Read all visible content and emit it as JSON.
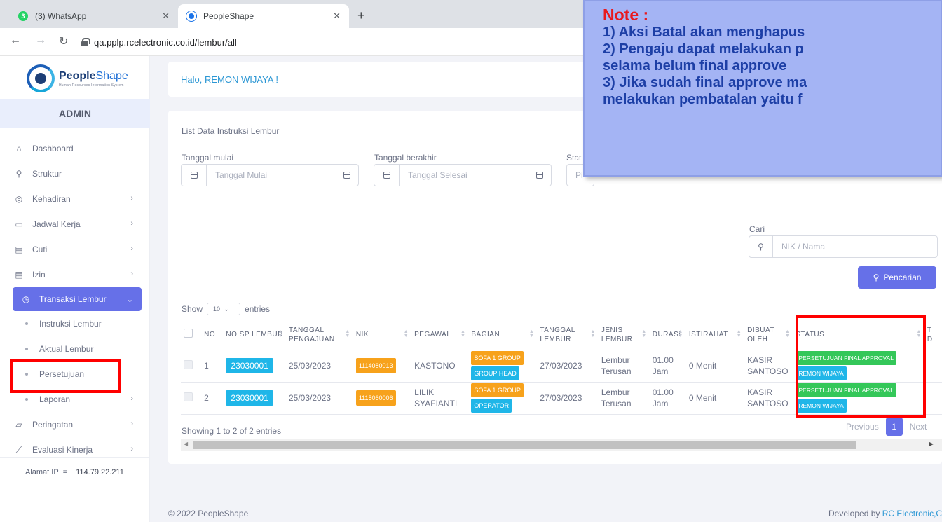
{
  "browser": {
    "tabs": [
      {
        "title": "(3) WhatsApp",
        "badge": "3"
      },
      {
        "title": "PeopleShape"
      }
    ],
    "url": "qa.pplp.rcelectronic.co.id/lembur/all"
  },
  "brand": {
    "name_a": "People",
    "name_b": "Shape",
    "subtitle": "Human Resources Information System"
  },
  "role": "ADMIN",
  "sidebar": {
    "items": [
      {
        "label": "Dashboard",
        "icon": "home-icon"
      },
      {
        "label": "Struktur",
        "icon": "org-chart-icon"
      },
      {
        "label": "Kehadiran",
        "icon": "fingerprint-icon"
      },
      {
        "label": "Jadwal Kerja",
        "icon": "briefcase-icon"
      },
      {
        "label": "Cuti",
        "icon": "calendar-icon"
      },
      {
        "label": "Izin",
        "icon": "calendar-icon"
      },
      {
        "label": "Transaksi Lembur",
        "icon": "clock-icon"
      },
      {
        "label": "Instruksi Lembur"
      },
      {
        "label": "Aktual Lembur"
      },
      {
        "label": "Persetujuan"
      },
      {
        "label": "Laporan"
      },
      {
        "label": "Peringatan",
        "icon": "warning-doc-icon"
      },
      {
        "label": "Evaluasi Kinerja",
        "icon": "chart-line-icon"
      }
    ],
    "ip_label": "Alamat IP",
    "ip_sep": "=",
    "ip_value": "114.79.22.211"
  },
  "greeting": {
    "prefix": "Halo,",
    "name": "REMON WIJAYA !"
  },
  "list_title": "List Data Instruksi Lembur",
  "filters": {
    "start_label": "Tanggal mulai",
    "start_placeholder": "Tanggal Mulai",
    "end_label": "Tanggal berakhir",
    "end_placeholder": "Tanggal Selesai",
    "status_label": "Stat",
    "status_placeholder": "Pi",
    "search_label": "Cari",
    "search_placeholder": "NIK / Nama",
    "search_button": "Pencarian"
  },
  "table": {
    "show_label": "Show",
    "page_size": "10",
    "entries_label": "entries",
    "headers": [
      "NO",
      "NO SP LEMBUR",
      "TANGGAL PENGAJUAN",
      "NIK",
      "PEGAWAI",
      "BAGIAN",
      "TANGGAL LEMBUR",
      "JENIS LEMBUR",
      "DURASI",
      "ISTIRAHAT",
      "DIBUAT OLEH",
      "STATUS",
      "T D"
    ],
    "rows": [
      {
        "no": "1",
        "sp": "23030001",
        "tgl_pengajuan": "25/03/2023",
        "nik": "1114080013",
        "pegawai": "KASTONO",
        "grup": "SOFA 1 GROUP",
        "jabatan": "GROUP HEAD",
        "tgl_lembur": "27/03/2023",
        "jenis": "Lembur Terusan",
        "durasi": "01.00 Jam",
        "istirahat": "0 Menit",
        "dibuat": "KASIR SANTOSO",
        "status": "PERSETUJUAN FINAL APPROVAL",
        "approver": "REMON WIJAYA"
      },
      {
        "no": "2",
        "sp": "23030001",
        "tgl_pengajuan": "25/03/2023",
        "nik": "1115060006",
        "pegawai": "LILIK SYAFIANTI",
        "grup": "SOFA 1 GROUP",
        "jabatan": "OPERATOR",
        "tgl_lembur": "27/03/2023",
        "jenis": "Lembur Terusan",
        "durasi": "01.00 Jam",
        "istirahat": "0 Menit",
        "dibuat": "KASIR SANTOSO",
        "status": "PERSETUJUAN FINAL APPROVAL",
        "approver": "REMON WIJAYA"
      }
    ],
    "showing": "Showing 1 to 2 of 2 entries",
    "prev": "Previous",
    "page": "1",
    "next": "Next"
  },
  "footer": {
    "copyright": "© 2022 PeopleShape",
    "dev_prefix": "Developed by",
    "dev_name": "RC Electronic,C"
  },
  "note": {
    "title": "Note :",
    "lines": [
      "1) Aksi Batal akan menghapus",
      "2) Pengaju dapat melakukan p",
      "selama belum final approve",
      "3) Jika sudah final approve ma",
      "melakukan pembatalan yaitu f"
    ]
  },
  "colors": {
    "accent": "#6670e8",
    "highlight": "#ff0000",
    "note_bg": "#a4b4f4",
    "note_title": "#e8191e",
    "note_text": "#1d3fa6"
  }
}
